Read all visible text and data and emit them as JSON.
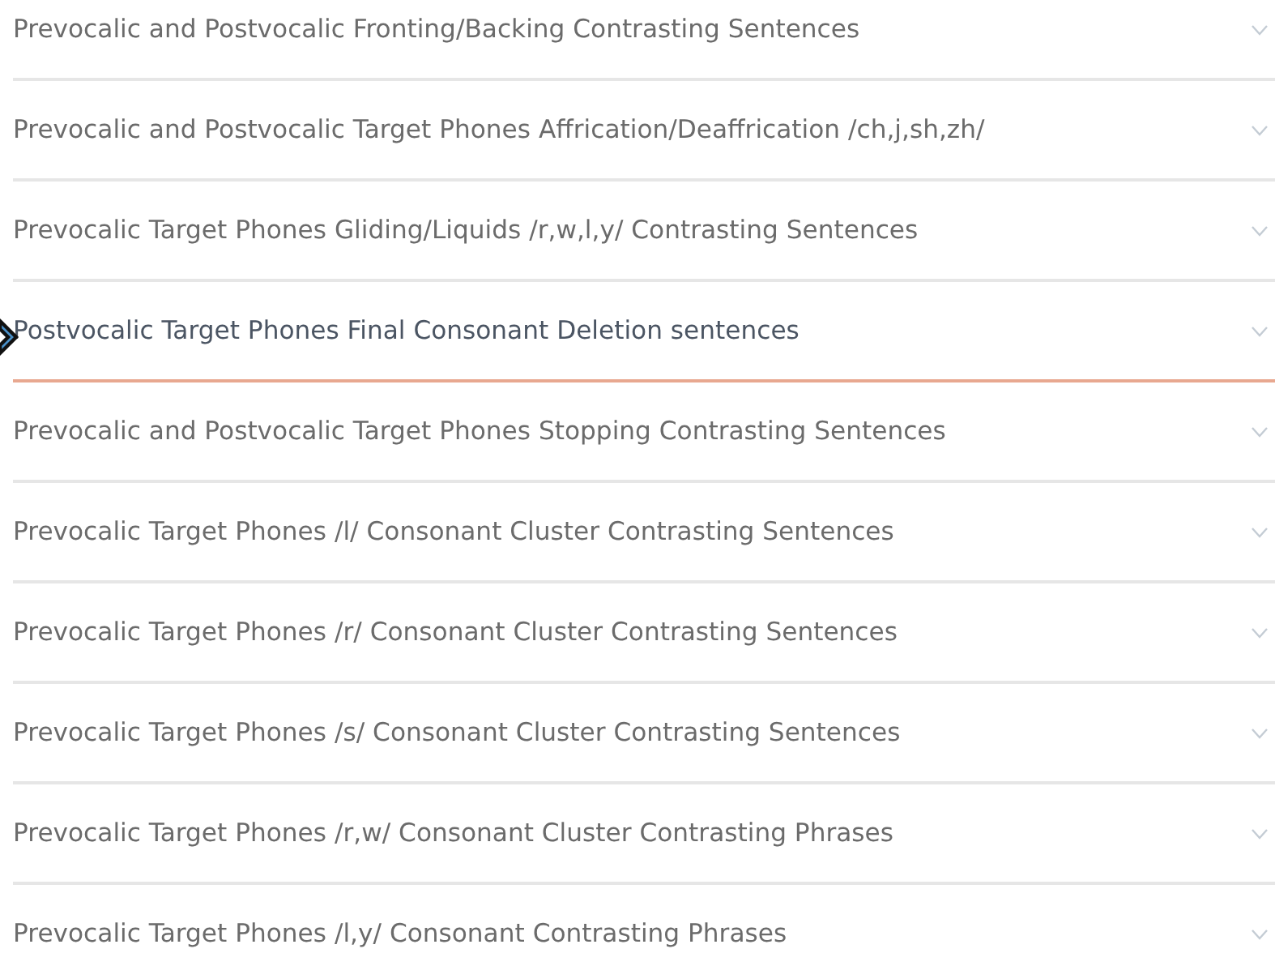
{
  "items": [
    {
      "label": "Prevocalic and Postvocalic Fronting/Backing Contrasting Sentences",
      "expanded": false,
      "hovered": false
    },
    {
      "label": "Prevocalic and Postvocalic Target Phones Affrication/Deaffrication /ch,j,sh,zh/",
      "expanded": false,
      "hovered": false
    },
    {
      "label": "Prevocalic Target Phones Gliding/Liquids /r,w,l,y/ Contrasting Sentences",
      "expanded": false,
      "hovered": false
    },
    {
      "label": "Postvocalic Target Phones Final Consonant Deletion sentences",
      "expanded": false,
      "hovered": true
    },
    {
      "label": "Prevocalic and Postvocalic Target Phones Stopping Contrasting Sentences",
      "expanded": false,
      "hovered": false
    },
    {
      "label": "Prevocalic Target Phones /l/ Consonant Cluster Contrasting Sentences",
      "expanded": false,
      "hovered": false
    },
    {
      "label": "Prevocalic Target Phones /r/ Consonant Cluster Contrasting Sentences",
      "expanded": false,
      "hovered": false
    },
    {
      "label": "Prevocalic Target Phones /s/ Consonant Cluster Contrasting Sentences",
      "expanded": false,
      "hovered": false
    },
    {
      "label": "Prevocalic Target Phones /r,w/ Consonant Cluster Contrasting Phrases",
      "expanded": false,
      "hovered": false
    },
    {
      "label": "Prevocalic Target Phones /l,y/ Consonant Contrasting Phrases",
      "expanded": false,
      "hovered": false
    }
  ]
}
